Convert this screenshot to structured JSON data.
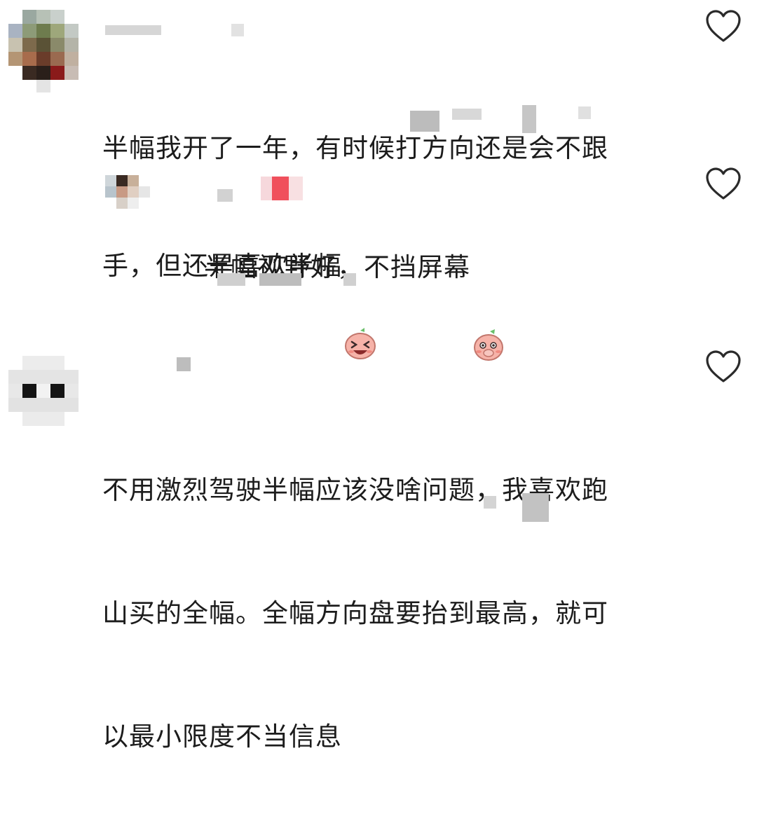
{
  "comments": [
    {
      "text_line1": "半幅我开了一年，有时候打方向还是会不跟",
      "text_line2": "手，但还是喜欢半幅",
      "emoji": "laughing-face-emoji",
      "like_icon": "heart-outline-icon"
    },
    {
      "reply_text": "半幅视野好，不挡屏幕",
      "emoji": "shy-face-emoji",
      "like_icon": "heart-outline-icon"
    },
    {
      "text_line1": "不用激烈驾驶半幅应该没啥问题，我喜欢跑",
      "text_line2": "山买的全幅。全幅方向盘要抬到最高，就可",
      "text_line3": "以最小限度不当信息",
      "like_icon": "heart-outline-icon"
    }
  ],
  "colors": {
    "text": "#1c1c1c",
    "heart_stroke": "#2a2a2a",
    "blur_gray": "#cfcfcf",
    "emoji_pink": "#f4a7a0",
    "reply_badge_red": "#f0505c"
  }
}
